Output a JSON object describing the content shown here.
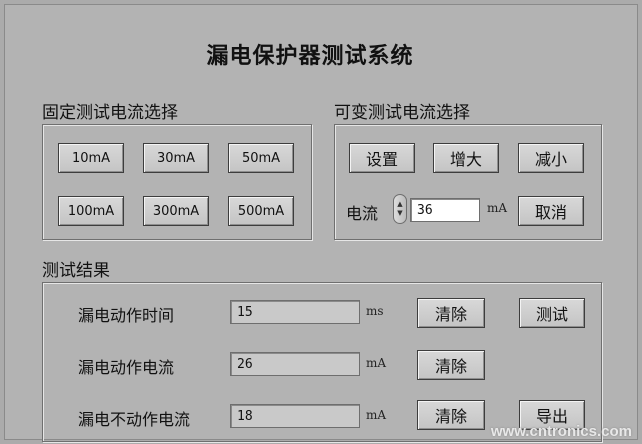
{
  "title": "漏电保护器测试系统",
  "fixed": {
    "label": "固定测试电流选择",
    "buttons": [
      "10mA",
      "30mA",
      "50mA",
      "100mA",
      "300mA",
      "500mA"
    ]
  },
  "variable": {
    "label": "可变测试电流选择",
    "set_label": "设置",
    "increase_label": "增大",
    "decrease_label": "减小",
    "current_label": "电流",
    "current_value": "36",
    "current_unit": "mA",
    "cancel_label": "取消"
  },
  "results": {
    "label": "测试结果",
    "rows": [
      {
        "label": "漏电动作时间",
        "value": "15",
        "unit": "ms",
        "clear_label": "清除"
      },
      {
        "label": "漏电动作电流",
        "value": "26",
        "unit": "mA",
        "clear_label": "清除"
      },
      {
        "label": "漏电不动作电流",
        "value": "18",
        "unit": "mA",
        "clear_label": "清除"
      }
    ],
    "test_label": "测试",
    "export_label": "导出"
  },
  "watermark": "www.cntronics.com"
}
